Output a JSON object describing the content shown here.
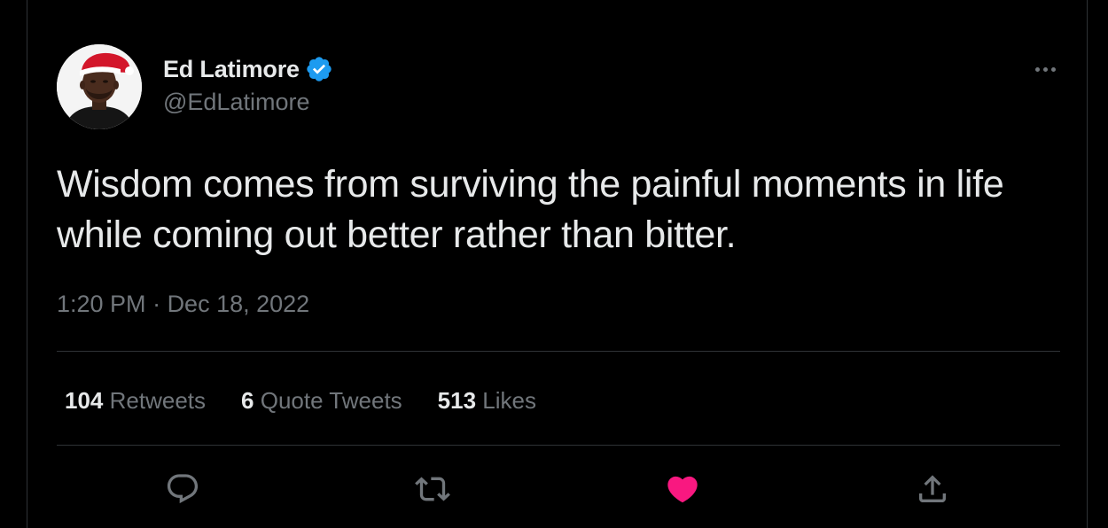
{
  "author": {
    "name": "Ed Latimore",
    "handle": "@EdLatimore",
    "verified": true
  },
  "tweet": {
    "text": "Wisdom comes from surviving the painful moments in life while coming out better rather than bitter.",
    "time": "1:20 PM",
    "separator": " · ",
    "date": "Dec 18, 2022"
  },
  "stats": {
    "retweets_count": "104",
    "retweets_label": "Retweets",
    "quotes_count": "6",
    "quotes_label": "Quote Tweets",
    "likes_count": "513",
    "likes_label": "Likes"
  },
  "actions": {
    "reply_icon": "reply-icon",
    "retweet_icon": "retweet-icon",
    "like_icon": "heart-icon",
    "share_icon": "share-icon"
  },
  "colors": {
    "background": "#000000",
    "text": "#e7e9ea",
    "secondary": "#71767b",
    "verified": "#1d9bf0",
    "like": "#f91880",
    "divider": "#2f3336"
  }
}
